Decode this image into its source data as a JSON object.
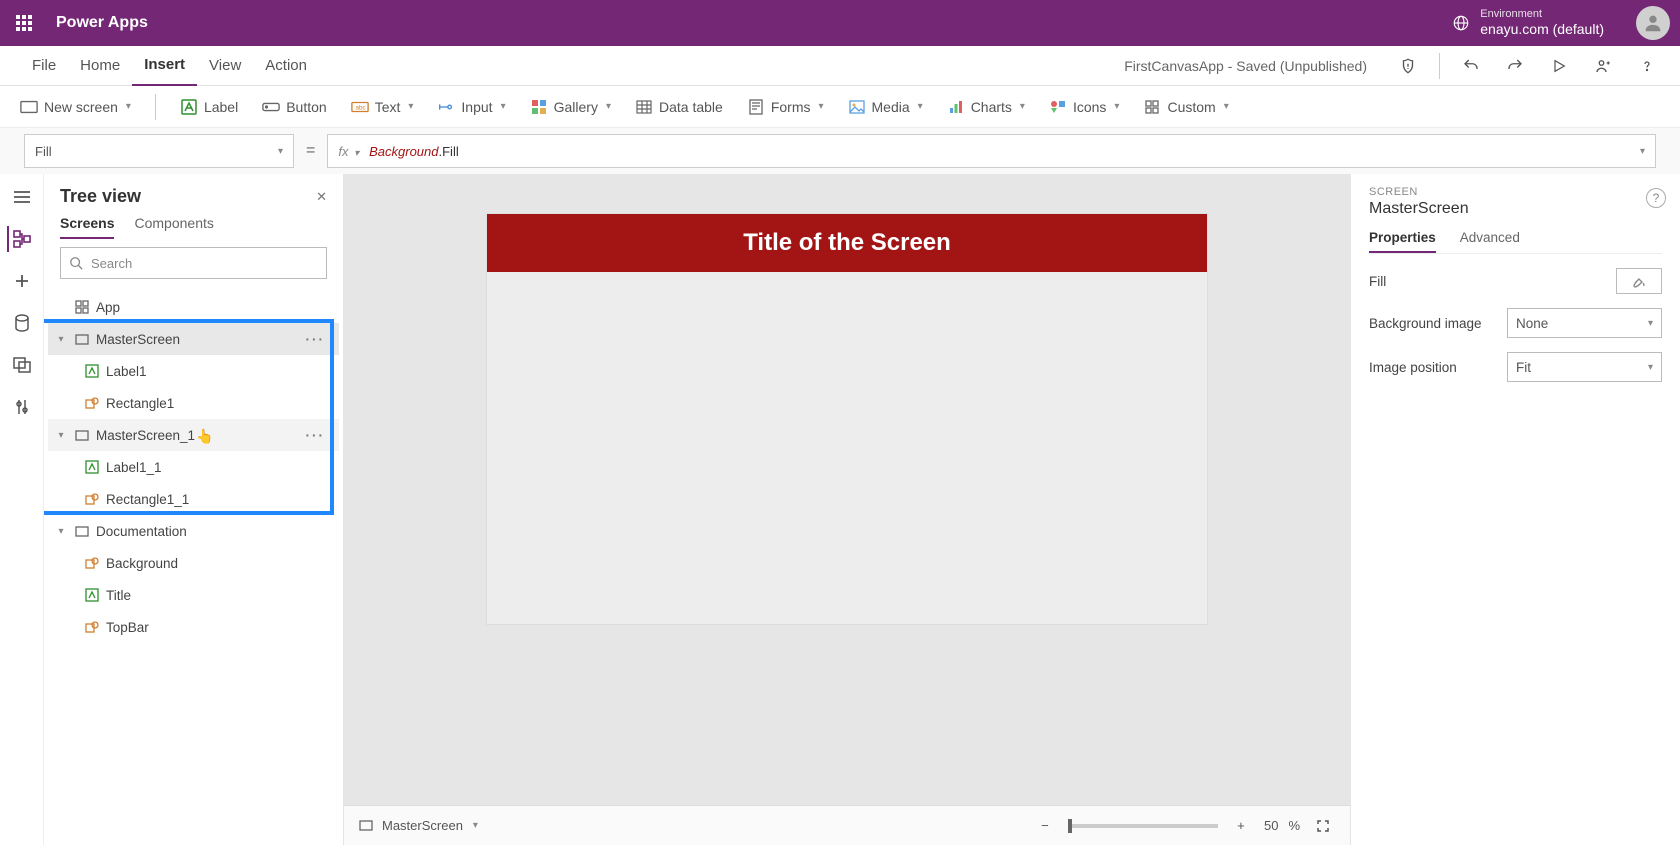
{
  "header": {
    "app_title": "Power Apps",
    "env_label": "Environment",
    "env_name": "enayu.com (default)"
  },
  "menubar": {
    "items": [
      "File",
      "Home",
      "Insert",
      "View",
      "Action"
    ],
    "active_index": 2,
    "status": "FirstCanvasApp - Saved (Unpublished)"
  },
  "ribbon": {
    "new_screen": "New screen",
    "label": "Label",
    "button": "Button",
    "text": "Text",
    "input": "Input",
    "gallery": "Gallery",
    "data_table": "Data table",
    "forms": "Forms",
    "media": "Media",
    "charts": "Charts",
    "icons": "Icons",
    "custom": "Custom"
  },
  "formula": {
    "property": "Fill",
    "expr_obj": "Background",
    "expr_prop": ".Fill"
  },
  "tree": {
    "title": "Tree view",
    "tabs": [
      "Screens",
      "Components"
    ],
    "active_tab": 0,
    "search_placeholder": "Search",
    "items": {
      "app": "App",
      "master": "MasterScreen",
      "label1": "Label1",
      "rect1": "Rectangle1",
      "master1": "MasterScreen_1",
      "label1_1": "Label1_1",
      "rect1_1": "Rectangle1_1",
      "documentation": "Documentation",
      "background": "Background",
      "title": "Title",
      "topbar": "TopBar"
    }
  },
  "canvas": {
    "title_text": "Title of the Screen",
    "footer_screen": "MasterScreen",
    "zoom_pct": "50",
    "zoom_unit": "%"
  },
  "properties": {
    "caption": "SCREEN",
    "title": "MasterScreen",
    "tabs": [
      "Properties",
      "Advanced"
    ],
    "active_tab": 0,
    "fill_label": "Fill",
    "bgimg_label": "Background image",
    "bgimg_value": "None",
    "imgpos_label": "Image position",
    "imgpos_value": "Fit"
  }
}
